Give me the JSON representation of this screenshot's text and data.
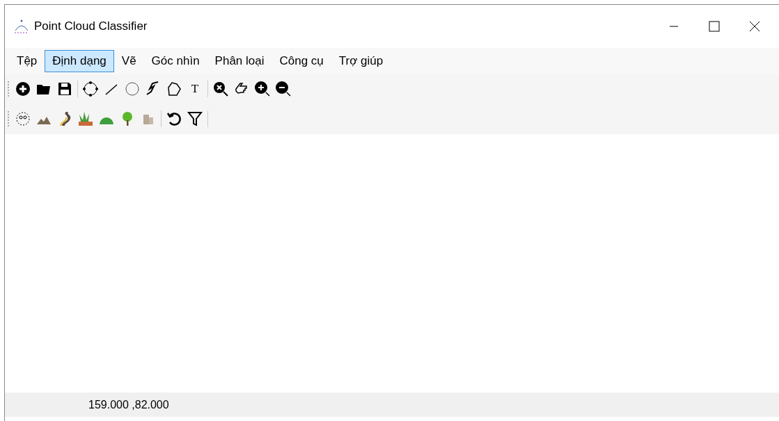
{
  "window": {
    "title": "Point Cloud Classifier"
  },
  "menu": [
    {
      "label": "Tệp",
      "selected": false
    },
    {
      "label": "Định dạng",
      "selected": true
    },
    {
      "label": "Vẽ",
      "selected": false
    },
    {
      "label": "Góc nhìn",
      "selected": false
    },
    {
      "label": "Phân loại",
      "selected": false
    },
    {
      "label": "Công cụ",
      "selected": false
    },
    {
      "label": "Trợ giúp",
      "selected": false
    }
  ],
  "text_tool": {
    "label": "T"
  },
  "status_bar": {
    "coordinates": "159.000 ,82.000"
  }
}
